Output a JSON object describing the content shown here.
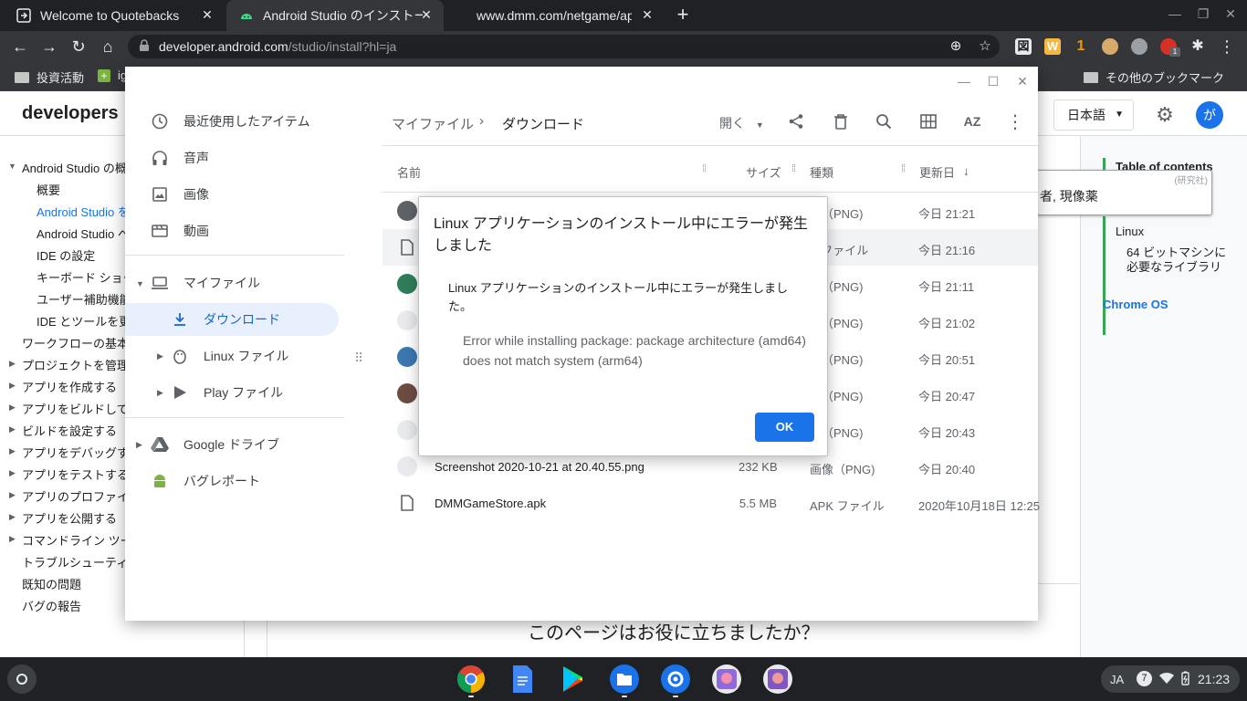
{
  "browser": {
    "tabs": [
      {
        "title": "Welcome to Quotebacks",
        "active": false
      },
      {
        "title": "Android Studio のインストール",
        "active": true
      },
      {
        "title": "www.dmm.com/netgame/app/",
        "active": false
      }
    ],
    "url_host": "developer.android.com",
    "url_path": "/studio/install?hl=ja",
    "bookmarks": [
      "投資活動",
      "ig",
      "その他のブックマーク"
    ],
    "ext_badge": "1"
  },
  "site": {
    "logo": "developers",
    "language": "日本語",
    "avatar": "が",
    "nav": [
      {
        "label": "Android Studio の概",
        "arrow": "expanded"
      },
      {
        "label": "概要"
      },
      {
        "label": "Android Studio を",
        "current": true
      },
      {
        "label": "Android Studio へ"
      },
      {
        "label": "IDE の設定"
      },
      {
        "label": "キーボード ショー"
      },
      {
        "label": "ユーザー補助機能"
      },
      {
        "label": "IDE とツールを更"
      },
      {
        "label": "ワークフローの基本"
      },
      {
        "label": "プロジェクトを管理",
        "arrow": "collapsed"
      },
      {
        "label": "アプリを作成する",
        "arrow": "collapsed"
      },
      {
        "label": "アプリをビルドして",
        "arrow": "collapsed"
      },
      {
        "label": "ビルドを設定する",
        "arrow": "collapsed"
      },
      {
        "label": "アプリをデバッグす",
        "arrow": "collapsed"
      },
      {
        "label": "アプリをテストする",
        "arrow": "collapsed"
      },
      {
        "label": "アプリのプロファイ",
        "arrow": "collapsed"
      },
      {
        "label": "アプリを公開する",
        "arrow": "collapsed"
      },
      {
        "label": "コマンドライン ツー",
        "arrow": "collapsed"
      },
      {
        "label": "トラブルシューティ"
      },
      {
        "label": "既知の問題"
      },
      {
        "label": "バグの報告"
      }
    ],
    "feedback": "このページはお役に立ちましたか？",
    "toc": {
      "title": "Table of contents",
      "linux": "Linux",
      "linux_sub": "64 ビットマシンに必要なライブラリ",
      "chrome_os": "Chrome OS"
    },
    "tooltip": {
      "small": "(研究社)",
      "text": "者, 現像薬"
    }
  },
  "files_app": {
    "sidebar": {
      "recent": "最近使用したアイテム",
      "audio": "音声",
      "images": "画像",
      "videos": "動画",
      "my_files": "マイファイル",
      "downloads": "ダウンロード",
      "linux_files": "Linux ファイル",
      "play_files": "Play ファイル",
      "google_drive": "Google ドライブ",
      "bug_report": "バグレポート"
    },
    "breadcrumb": {
      "root": "マイファイル",
      "separator": "›",
      "current": "ダウンロード"
    },
    "toolbar": {
      "open": "開く",
      "sort": "AZ"
    },
    "columns": {
      "name": "名前",
      "size": "サイズ",
      "type": "種類",
      "modified": "更新日"
    },
    "files": [
      {
        "name": "",
        "size": "",
        "type": "像（PNG)",
        "date": "今日 21:21",
        "icon_color": "#5f6368"
      },
      {
        "name": "",
        "size": "",
        "type": "B ファイル",
        "date": "今日 21:16",
        "icon_color": "#5f6368",
        "selected": true
      },
      {
        "name": "",
        "size": "",
        "type": "像（PNG)",
        "date": "今日 21:11",
        "icon_color": "#2e7d5b"
      },
      {
        "name": "",
        "size": "",
        "type": "像（PNG)",
        "date": "今日 21:02",
        "icon_color": "#e8eaed"
      },
      {
        "name": "",
        "size": "",
        "type": "像（PNG)",
        "date": "今日 20:51",
        "icon_color": "#3b78b0"
      },
      {
        "name": "",
        "size": "",
        "type": "像（PNG)",
        "date": "今日 20:47",
        "icon_color": "#6d4c41"
      },
      {
        "name": "",
        "size": "",
        "type": "像（PNG)",
        "date": "今日 20:43",
        "icon_color": "#e8eaed"
      },
      {
        "name": "Screenshot 2020-10-21 at 20.40.55.png",
        "size": "232 KB",
        "type": "画像（PNG)",
        "date": "今日 20:40",
        "icon_color": "#e8eaed"
      },
      {
        "name": "DMMGameStore.apk",
        "size": "5.5 MB",
        "type": "APK ファイル",
        "date": "2020年10月18日 12:25",
        "icon_color": "#5f6368"
      }
    ]
  },
  "dialog": {
    "title": "Linux アプリケーションのインストール中にエラーが発生しました",
    "message": "Linux アプリケーションのインストール中にエラーが発生しました。",
    "detail": "Error while installing package: package architecture (amd64) does not match system (arm64)",
    "ok": "OK"
  },
  "shelf": {
    "ime": "JA",
    "notifications": "7",
    "time": "21:23"
  },
  "colors": {
    "accent": "#1a73e8",
    "chrome_dark": "#202124",
    "chrome_mid": "#35363a"
  }
}
